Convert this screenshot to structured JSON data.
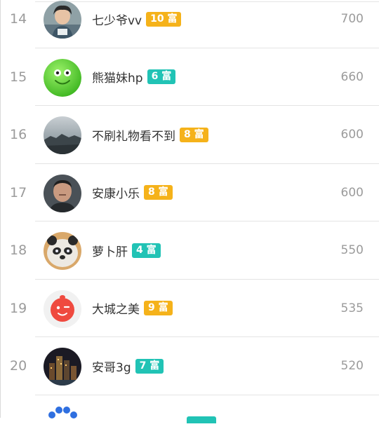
{
  "colors": {
    "badge_orange": "#f5b21a",
    "badge_teal": "#21c3b5",
    "rank_gray": "#9b9b9b"
  },
  "rows": [
    {
      "rank": "14",
      "name": "七少爷vv",
      "badge": "10 富",
      "badge_color": "#f5b21a",
      "score": "700",
      "avatar": "avatar-photo-boy"
    },
    {
      "rank": "15",
      "name": "熊猫妹hp",
      "badge": "6 富",
      "badge_color": "#21c3b5",
      "score": "660",
      "avatar": "avatar-green-smiley"
    },
    {
      "rank": "16",
      "name": "不刷礼物看不到",
      "badge": "8 富",
      "badge_color": "#f5b21a",
      "score": "600",
      "avatar": "avatar-photo-landscape"
    },
    {
      "rank": "17",
      "name": "安康小乐",
      "badge": "8 富",
      "badge_color": "#f5b21a",
      "score": "600",
      "avatar": "avatar-photo-man"
    },
    {
      "rank": "18",
      "name": "萝卜肝",
      "badge": "4 富",
      "badge_color": "#21c3b5",
      "score": "550",
      "avatar": "avatar-panda"
    },
    {
      "rank": "19",
      "name": "大城之美",
      "badge": "9 富",
      "badge_color": "#f5b21a",
      "score": "535",
      "avatar": "avatar-red-face"
    },
    {
      "rank": "20",
      "name": "安哥3g",
      "badge": "7 富",
      "badge_color": "#21c3b5",
      "score": "520",
      "avatar": "avatar-photo-city"
    }
  ],
  "partial_row": {
    "avatar": "avatar-paw",
    "badge_color": "#21c3b5"
  }
}
